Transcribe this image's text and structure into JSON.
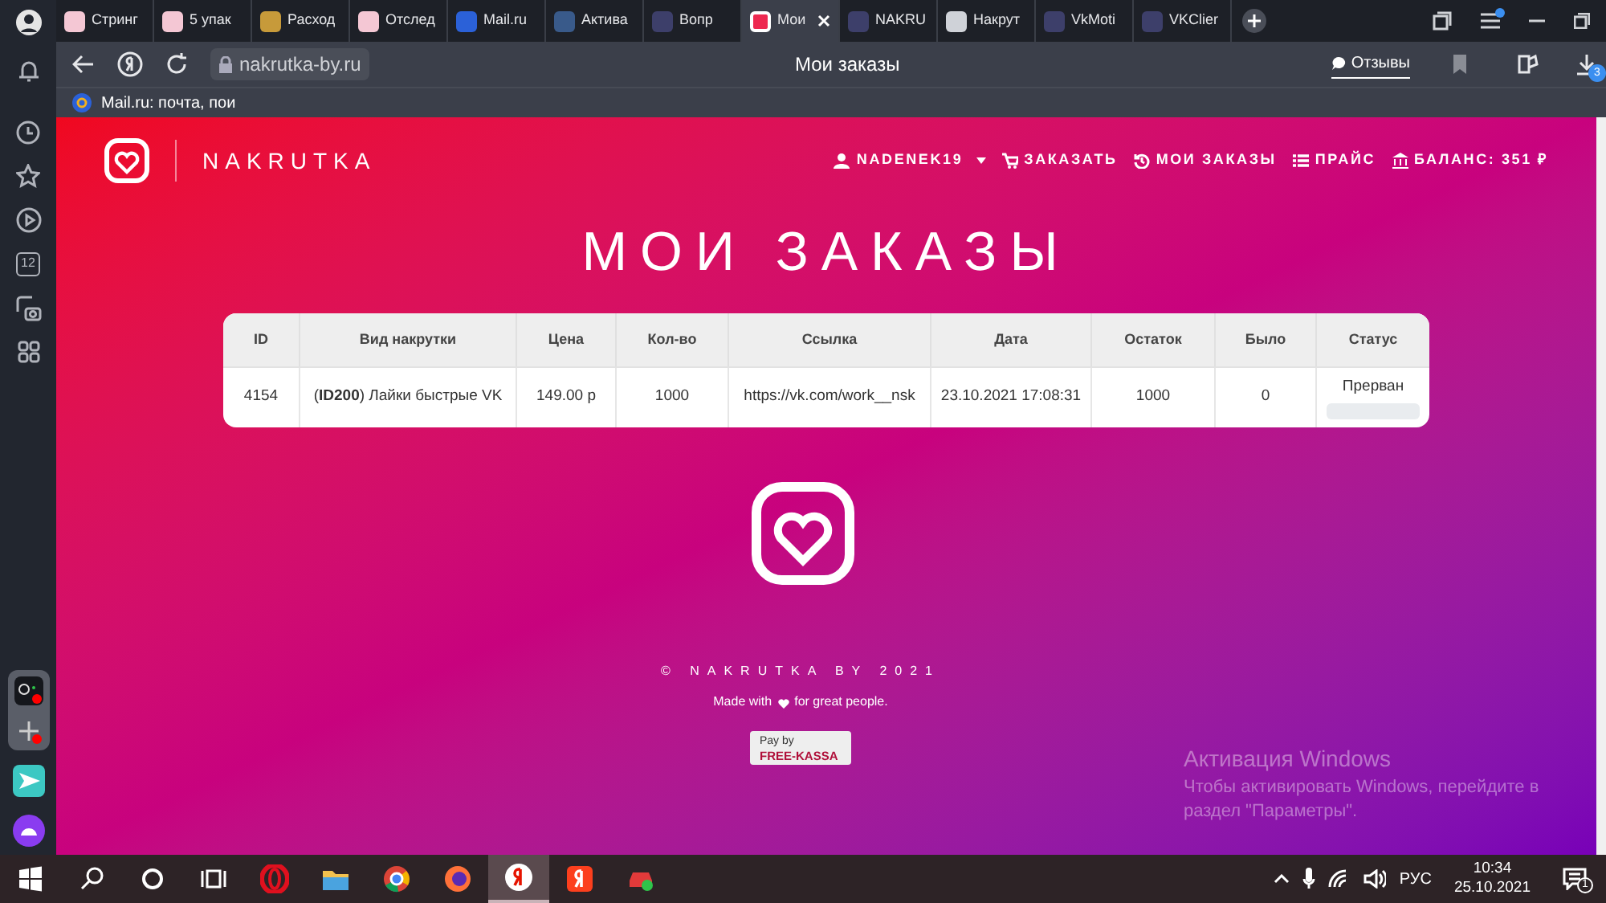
{
  "browser": {
    "tabs": [
      {
        "title": "Стринг",
        "selected": false
      },
      {
        "title": "5 упак",
        "selected": false
      },
      {
        "title": "Расход",
        "selected": false
      },
      {
        "title": "Отслед",
        "selected": false
      },
      {
        "title": "Mail.ru",
        "selected": false
      },
      {
        "title": "Актива",
        "selected": false
      },
      {
        "title": "Вопр",
        "selected": false
      },
      {
        "title": "Мои",
        "selected": true
      },
      {
        "title": "NAKRU",
        "selected": false
      },
      {
        "title": "Накрут",
        "selected": false
      },
      {
        "title": "VkMoti",
        "selected": false
      },
      {
        "title": "VKClier",
        "selected": false
      }
    ],
    "downloads_badge": "3",
    "address": "nakrutka-by.ru",
    "page_title": "Мои заказы",
    "reviews": "Отзывы",
    "bookmarks": [
      "Mail.ru: почта, пои"
    ],
    "sidebar_calendar": "12"
  },
  "site": {
    "logo": "NAKRUTKA",
    "nav": [
      {
        "kind": "user",
        "label": "NADENEK19"
      },
      {
        "kind": "cart",
        "label": "ЗАКАЗАТЬ"
      },
      {
        "kind": "history",
        "label": "МОИ ЗАКАЗЫ"
      },
      {
        "kind": "list",
        "label": "ПРАЙС"
      },
      {
        "kind": "bank",
        "label": "БАЛАНС: 351 ₽"
      }
    ],
    "heading": "МОИ ЗАКАЗЫ",
    "table": {
      "columns": [
        "ID",
        "Вид накрутки",
        "Цена",
        "Кол-во",
        "Ссылка",
        "Дата",
        "Остаток",
        "Было",
        "Статус"
      ],
      "rows": [
        {
          "id": "4154",
          "type": "(**ID200**) Лайки быстрые VK",
          "price": "149.00 р",
          "quantity": "1000",
          "link": "https://vk.com/work__nsk",
          "date": "23.10.2021 17:08:31",
          "remaining": "1000",
          "was": "0",
          "status": "Прерван",
          "level": 0
        }
      ]
    },
    "copyright": "© NAKRUTKA BY 2021",
    "made_with": "Made with",
    "made_for": "for great people.",
    "pay_by": "Pay by",
    "pay_brand": "FREE-KASSA"
  },
  "activation": {
    "title": "Активация Windows",
    "text": "Чтобы активировать Windows, перейдите в раздел \"Параметры\"."
  },
  "taskbar": {
    "language": "РУС",
    "time": "10:34",
    "date": "25.10.2021",
    "notifications": "1"
  }
}
